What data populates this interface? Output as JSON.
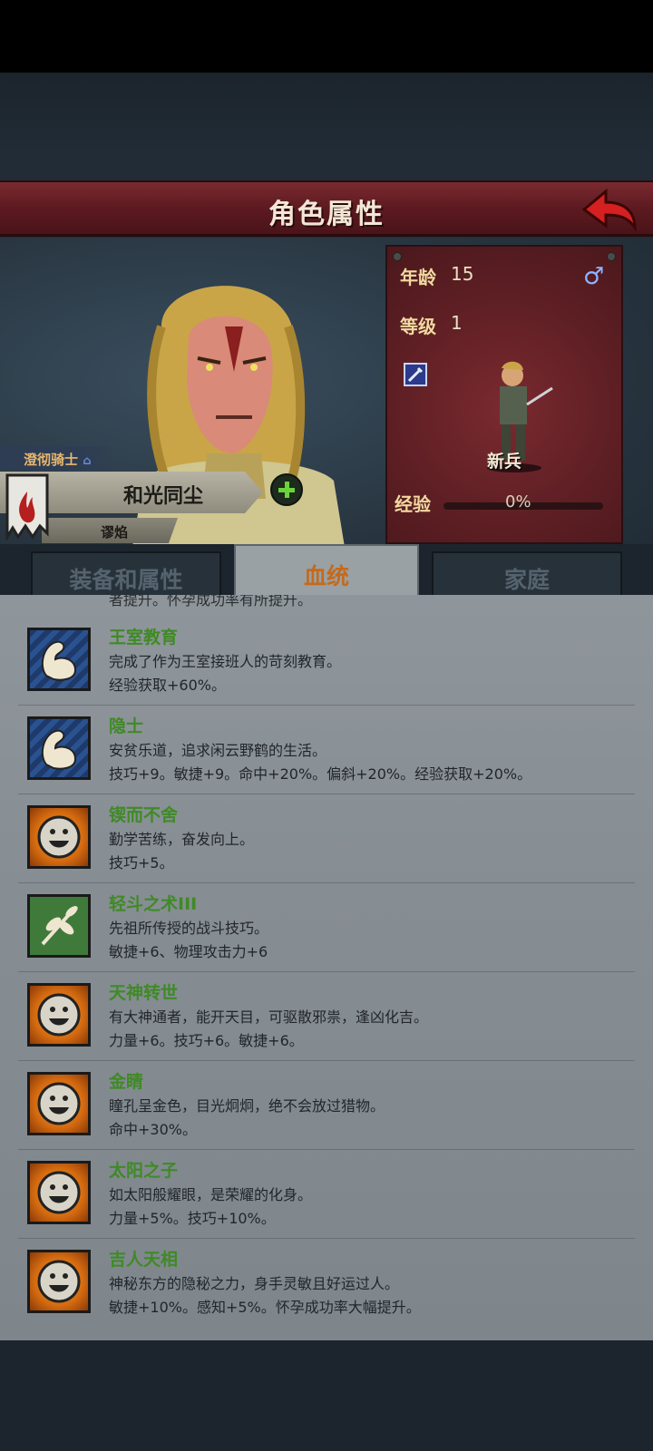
{
  "header": {
    "title": "角色属性"
  },
  "character": {
    "class_badge": "澄彻骑士",
    "name": "和光同尘",
    "house": "谬焰"
  },
  "stats": {
    "age_label": "年龄",
    "age_value": "15",
    "level_label": "等级",
    "level_value": "1",
    "unit_label": "新兵",
    "exp_label": "经验",
    "exp_value": "0%",
    "exp_fraction": 0
  },
  "tabs": [
    {
      "label": "装备和属性",
      "active": false
    },
    {
      "label": "血统",
      "active": true
    },
    {
      "label": "家庭",
      "active": false
    }
  ],
  "list": {
    "cut_off_text": "者提升。怀孕成功率有所提升。",
    "traits": [
      {
        "name": "王室教育",
        "desc": "完成了作为王室接班人的苛刻教育。",
        "effect": "经验获取+60%。",
        "icon": "flexed-arm-icon"
      },
      {
        "name": "隐士",
        "desc": "安贫乐道，追求闲云野鹤的生活。",
        "effect": "技巧+9。敏捷+9。命中+20%。偏斜+20%。经验获取+20%。",
        "icon": "flexed-arm-icon"
      },
      {
        "name": "锲而不舍",
        "desc": "勤学苦练，奋发向上。",
        "effect": "技巧+5。",
        "icon": "smiley-sun-icon"
      },
      {
        "name": "轻斗之术III",
        "desc": "先祖所传授的战斗技巧。",
        "effect": "敏捷+6、物理攻击力+6",
        "icon": "leaf-branch-icon"
      },
      {
        "name": "天神转世",
        "desc": "有大神通者，能开天目，可驱散邪祟，逢凶化吉。",
        "effect": "力量+6。技巧+6。敏捷+6。",
        "icon": "smiley-sun-icon"
      },
      {
        "name": "金睛",
        "desc": "瞳孔呈金色，目光炯炯，绝不会放过猎物。",
        "effect": "命中+30%。",
        "icon": "smiley-sun-icon"
      },
      {
        "name": "太阳之子",
        "desc": "如太阳般耀眼，是荣耀的化身。",
        "effect": "力量+5%。技巧+10%。",
        "icon": "smiley-sun-icon"
      },
      {
        "name": "吉人天相",
        "desc": "神秘东方的隐秘之力，身手灵敏且好运过人。",
        "effect": "敏捷+10%。感知+5%。怀孕成功率大幅提升。",
        "icon": "smiley-sun-icon"
      }
    ]
  }
}
